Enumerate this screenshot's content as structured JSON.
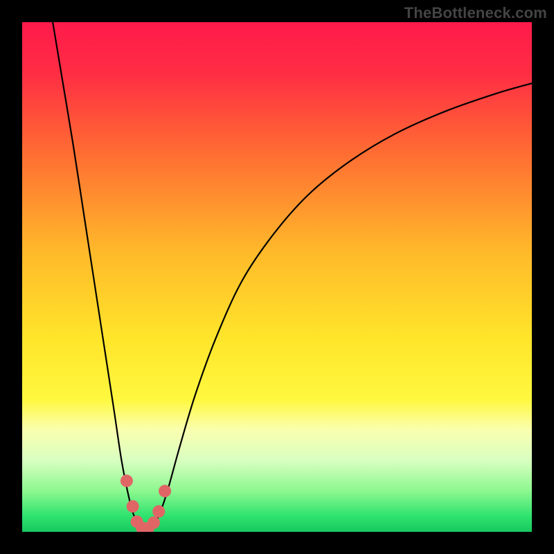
{
  "watermark": "TheBottleneck.com",
  "chart_data": {
    "type": "line",
    "title": "",
    "xlabel": "",
    "ylabel": "",
    "xlim": [
      0,
      100
    ],
    "ylim": [
      0,
      100
    ],
    "background_gradient": {
      "stops": [
        {
          "offset": 0.0,
          "color": "#ff1a4b"
        },
        {
          "offset": 0.1,
          "color": "#ff2d44"
        },
        {
          "offset": 0.25,
          "color": "#ff6a33"
        },
        {
          "offset": 0.45,
          "color": "#ffb92a"
        },
        {
          "offset": 0.62,
          "color": "#ffe52a"
        },
        {
          "offset": 0.74,
          "color": "#fff83f"
        },
        {
          "offset": 0.8,
          "color": "#faffb0"
        },
        {
          "offset": 0.86,
          "color": "#d8ffc0"
        },
        {
          "offset": 0.92,
          "color": "#8cf78f"
        },
        {
          "offset": 0.97,
          "color": "#2de26e"
        },
        {
          "offset": 1.0,
          "color": "#18c95f"
        }
      ]
    },
    "series": [
      {
        "name": "bottleneck-curve",
        "color": "#000000",
        "stroke_width": 2.2,
        "points": [
          {
            "x": 6.0,
            "y": 100.0
          },
          {
            "x": 8.0,
            "y": 88.0
          },
          {
            "x": 10.0,
            "y": 76.0
          },
          {
            "x": 12.0,
            "y": 63.0
          },
          {
            "x": 14.0,
            "y": 50.0
          },
          {
            "x": 16.0,
            "y": 37.0
          },
          {
            "x": 18.0,
            "y": 24.0
          },
          {
            "x": 19.5,
            "y": 14.0
          },
          {
            "x": 21.0,
            "y": 6.5
          },
          {
            "x": 22.0,
            "y": 3.0
          },
          {
            "x": 23.0,
            "y": 1.2
          },
          {
            "x": 24.0,
            "y": 0.4
          },
          {
            "x": 25.0,
            "y": 0.6
          },
          {
            "x": 26.0,
            "y": 1.6
          },
          {
            "x": 27.0,
            "y": 3.6
          },
          {
            "x": 28.5,
            "y": 8.0
          },
          {
            "x": 31.0,
            "y": 17.0
          },
          {
            "x": 34.0,
            "y": 27.0
          },
          {
            "x": 38.0,
            "y": 38.0
          },
          {
            "x": 43.0,
            "y": 49.0
          },
          {
            "x": 49.0,
            "y": 58.0
          },
          {
            "x": 56.0,
            "y": 66.0
          },
          {
            "x": 64.0,
            "y": 72.5
          },
          {
            "x": 73.0,
            "y": 78.0
          },
          {
            "x": 83.0,
            "y": 82.5
          },
          {
            "x": 93.0,
            "y": 86.0
          },
          {
            "x": 100.0,
            "y": 88.0
          }
        ]
      }
    ],
    "markers": {
      "name": "highlighted-points",
      "color": "#e06666",
      "radius": 9,
      "points": [
        {
          "x": 20.5,
          "y": 10.0
        },
        {
          "x": 21.7,
          "y": 5.0
        },
        {
          "x": 22.5,
          "y": 2.0
        },
        {
          "x": 23.5,
          "y": 0.8
        },
        {
          "x": 24.7,
          "y": 0.7
        },
        {
          "x": 25.8,
          "y": 1.8
        },
        {
          "x": 26.8,
          "y": 4.0
        },
        {
          "x": 28.0,
          "y": 8.0
        }
      ]
    }
  }
}
